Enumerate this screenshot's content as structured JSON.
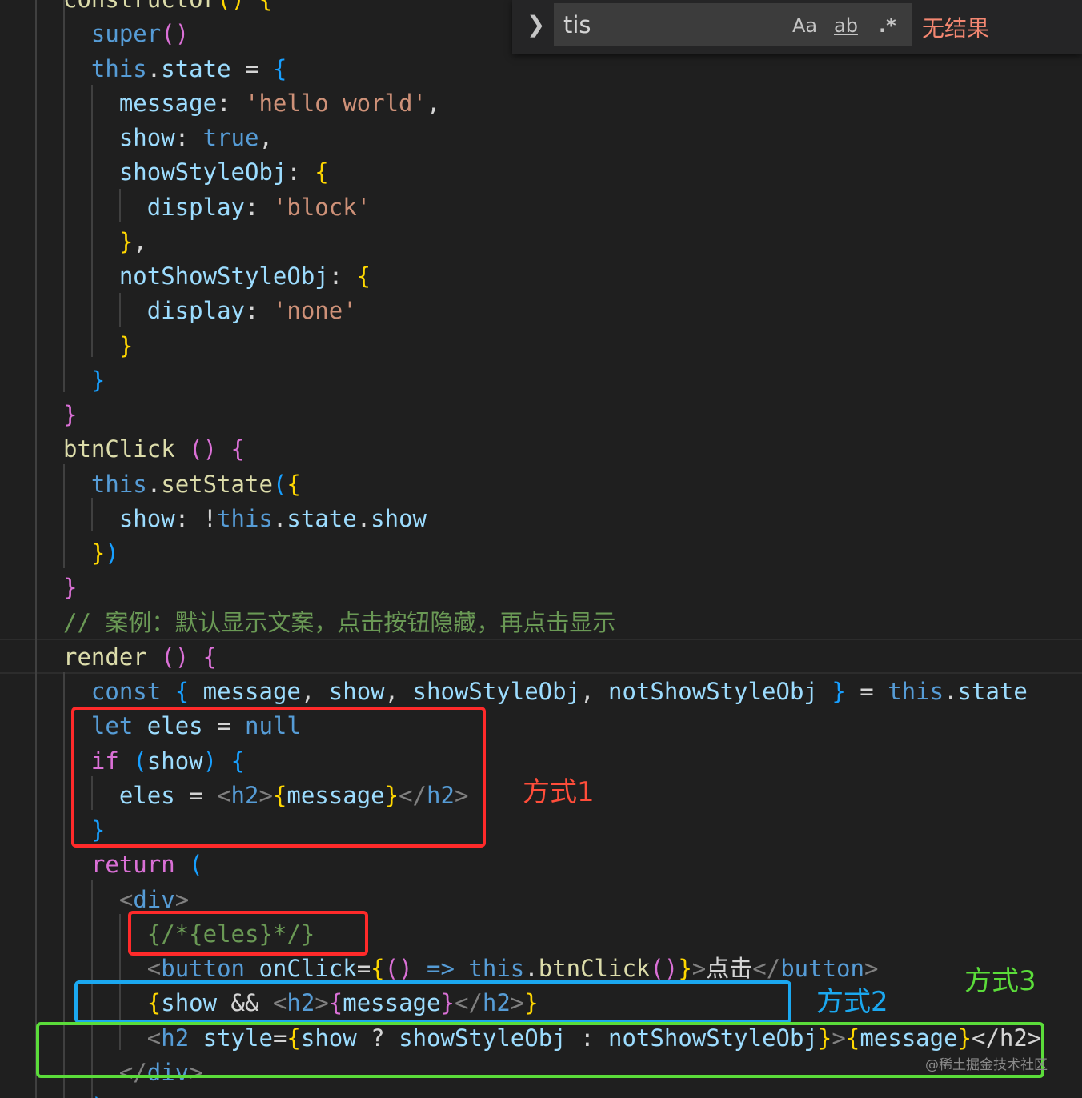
{
  "find_widget": {
    "query": "tis",
    "match_case": "Aa",
    "whole_word": "ab",
    "regex": ".*",
    "status": "无结果"
  },
  "code_lines": [
    [
      {
        "t": "constructor",
        "c": "t-func"
      },
      {
        "t": "() {",
        "c": "t-gold"
      }
    ],
    [
      {
        "t": "  "
      },
      {
        "t": "super",
        "c": "t-blue"
      },
      {
        "t": "()",
        "c": "t-pink"
      }
    ],
    [
      {
        "t": "  "
      },
      {
        "t": "this",
        "c": "t-blue"
      },
      {
        "t": "."
      },
      {
        "t": "state",
        "c": "t-var"
      },
      {
        "t": " = "
      },
      {
        "t": "{",
        "c": "t-bright"
      }
    ],
    [
      {
        "t": "    "
      },
      {
        "t": "message",
        "c": "t-var"
      },
      {
        "t": ": "
      },
      {
        "t": "'hello world'",
        "c": "t-str"
      },
      {
        "t": ","
      }
    ],
    [
      {
        "t": "    "
      },
      {
        "t": "show",
        "c": "t-var"
      },
      {
        "t": ": "
      },
      {
        "t": "true",
        "c": "t-blue"
      },
      {
        "t": ","
      }
    ],
    [
      {
        "t": "    "
      },
      {
        "t": "showStyleObj",
        "c": "t-var"
      },
      {
        "t": ": "
      },
      {
        "t": "{",
        "c": "t-gold"
      }
    ],
    [
      {
        "t": "      "
      },
      {
        "t": "display",
        "c": "t-var"
      },
      {
        "t": ": "
      },
      {
        "t": "'block'",
        "c": "t-str"
      }
    ],
    [
      {
        "t": "    "
      },
      {
        "t": "}",
        "c": "t-gold"
      },
      {
        "t": ","
      }
    ],
    [
      {
        "t": "    "
      },
      {
        "t": "notShowStyleObj",
        "c": "t-var"
      },
      {
        "t": ": "
      },
      {
        "t": "{",
        "c": "t-gold"
      }
    ],
    [
      {
        "t": "      "
      },
      {
        "t": "display",
        "c": "t-var"
      },
      {
        "t": ": "
      },
      {
        "t": "'none'",
        "c": "t-str"
      }
    ],
    [
      {
        "t": "    "
      },
      {
        "t": "}",
        "c": "t-gold"
      }
    ],
    [
      {
        "t": "  "
      },
      {
        "t": "}",
        "c": "t-bright"
      }
    ],
    [
      {
        "t": "}",
        "c": "t-pink"
      }
    ],
    [
      {
        "t": "btnClick",
        "c": "t-func"
      },
      {
        "t": " "
      },
      {
        "t": "()",
        "c": "t-pink"
      },
      {
        "t": " "
      },
      {
        "t": "{",
        "c": "t-pink"
      }
    ],
    [
      {
        "t": "  "
      },
      {
        "t": "this",
        "c": "t-blue"
      },
      {
        "t": "."
      },
      {
        "t": "setState",
        "c": "t-func"
      },
      {
        "t": "(",
        "c": "t-bright"
      },
      {
        "t": "{",
        "c": "t-gold"
      }
    ],
    [
      {
        "t": "    "
      },
      {
        "t": "show",
        "c": "t-var"
      },
      {
        "t": ": !"
      },
      {
        "t": "this",
        "c": "t-blue"
      },
      {
        "t": "."
      },
      {
        "t": "state",
        "c": "t-var"
      },
      {
        "t": "."
      },
      {
        "t": "show",
        "c": "t-var"
      }
    ],
    [
      {
        "t": "  "
      },
      {
        "t": "}",
        "c": "t-gold"
      },
      {
        "t": ")",
        "c": "t-bright"
      }
    ],
    [
      {
        "t": "}",
        "c": "t-pink"
      }
    ],
    [
      {
        "t": "// 案例：默认显示文案，点击按钮隐藏，再点击显示",
        "c": "t-com"
      }
    ],
    [
      {
        "t": "render",
        "c": "t-func"
      },
      {
        "t": " "
      },
      {
        "t": "()",
        "c": "t-pink"
      },
      {
        "t": " "
      },
      {
        "t": "{",
        "c": "t-pink"
      }
    ],
    [
      {
        "t": "  "
      },
      {
        "t": "const",
        "c": "t-blue"
      },
      {
        "t": " "
      },
      {
        "t": "{",
        "c": "t-bright"
      },
      {
        "t": " "
      },
      {
        "t": "message",
        "c": "t-var"
      },
      {
        "t": ", "
      },
      {
        "t": "show",
        "c": "t-var"
      },
      {
        "t": ", "
      },
      {
        "t": "showStyleObj",
        "c": "t-var"
      },
      {
        "t": ", "
      },
      {
        "t": "notShowStyleObj",
        "c": "t-var"
      },
      {
        "t": " "
      },
      {
        "t": "}",
        "c": "t-bright"
      },
      {
        "t": " = "
      },
      {
        "t": "this",
        "c": "t-blue"
      },
      {
        "t": "."
      },
      {
        "t": "state",
        "c": "t-var"
      }
    ],
    [
      {
        "t": "  "
      },
      {
        "t": "let",
        "c": "t-blue"
      },
      {
        "t": " "
      },
      {
        "t": "eles",
        "c": "t-var"
      },
      {
        "t": " = "
      },
      {
        "t": "null",
        "c": "t-blue"
      }
    ],
    [
      {
        "t": "  "
      },
      {
        "t": "if",
        "c": "t-pink"
      },
      {
        "t": " "
      },
      {
        "t": "(",
        "c": "t-bright"
      },
      {
        "t": "show",
        "c": "t-var"
      },
      {
        "t": ")",
        "c": "t-bright"
      },
      {
        "t": " "
      },
      {
        "t": "{",
        "c": "t-bright"
      }
    ],
    [
      {
        "t": "    "
      },
      {
        "t": "eles",
        "c": "t-var"
      },
      {
        "t": " = "
      },
      {
        "t": "<",
        "c": "t-tag"
      },
      {
        "t": "h2",
        "c": "t-blue"
      },
      {
        "t": ">",
        "c": "t-tag"
      },
      {
        "t": "{",
        "c": "t-gold"
      },
      {
        "t": "message",
        "c": "t-var"
      },
      {
        "t": "}",
        "c": "t-gold"
      },
      {
        "t": "</",
        "c": "t-tag"
      },
      {
        "t": "h2",
        "c": "t-blue"
      },
      {
        "t": ">",
        "c": "t-tag"
      }
    ],
    [
      {
        "t": "  "
      },
      {
        "t": "}",
        "c": "t-bright"
      }
    ],
    [
      {
        "t": "  "
      },
      {
        "t": "return",
        "c": "t-pink"
      },
      {
        "t": " "
      },
      {
        "t": "(",
        "c": "t-bright"
      }
    ],
    [
      {
        "t": "    "
      },
      {
        "t": "<",
        "c": "t-tag"
      },
      {
        "t": "div",
        "c": "t-blue"
      },
      {
        "t": ">",
        "c": "t-tag"
      }
    ],
    [
      {
        "t": "      "
      },
      {
        "t": "{/*{eles}*/}",
        "c": "t-com"
      }
    ],
    [
      {
        "t": "      "
      },
      {
        "t": "<",
        "c": "t-tag"
      },
      {
        "t": "button",
        "c": "t-blue"
      },
      {
        "t": " "
      },
      {
        "t": "onClick",
        "c": "t-var"
      },
      {
        "t": "="
      },
      {
        "t": "{",
        "c": "t-gold"
      },
      {
        "t": "()",
        "c": "t-pink"
      },
      {
        "t": " "
      },
      {
        "t": "=>",
        "c": "t-blue"
      },
      {
        "t": " "
      },
      {
        "t": "this",
        "c": "t-blue"
      },
      {
        "t": "."
      },
      {
        "t": "btnClick",
        "c": "t-func"
      },
      {
        "t": "()",
        "c": "t-pink"
      },
      {
        "t": "}",
        "c": "t-gold"
      },
      {
        "t": ">",
        "c": "t-tag"
      },
      {
        "t": "点击"
      },
      {
        "t": "</",
        "c": "t-tag"
      },
      {
        "t": "button",
        "c": "t-blue"
      },
      {
        "t": ">",
        "c": "t-tag"
      }
    ],
    [
      {
        "t": "      "
      },
      {
        "t": "{",
        "c": "t-gold"
      },
      {
        "t": "show",
        "c": "t-var"
      },
      {
        "t": " && "
      },
      {
        "t": "<",
        "c": "t-tag"
      },
      {
        "t": "h2",
        "c": "t-blue"
      },
      {
        "t": ">",
        "c": "t-tag"
      },
      {
        "t": "{",
        "c": "t-pink"
      },
      {
        "t": "message",
        "c": "t-var"
      },
      {
        "t": "}",
        "c": "t-pink"
      },
      {
        "t": "</",
        "c": "t-tag"
      },
      {
        "t": "h2",
        "c": "t-blue"
      },
      {
        "t": ">",
        "c": "t-tag"
      },
      {
        "t": "}",
        "c": "t-gold"
      }
    ],
    [
      {
        "t": "      "
      },
      {
        "t": "<",
        "c": "t-tag"
      },
      {
        "t": "h2",
        "c": "t-blue"
      },
      {
        "t": " "
      },
      {
        "t": "style",
        "c": "t-var"
      },
      {
        "t": "="
      },
      {
        "t": "{",
        "c": "t-gold"
      },
      {
        "t": "show",
        "c": "t-var"
      },
      {
        "t": " ? "
      },
      {
        "t": "showStyleObj",
        "c": "t-var"
      },
      {
        "t": " : "
      },
      {
        "t": "notShowStyleObj",
        "c": "t-var"
      },
      {
        "t": "}",
        "c": "t-gold"
      },
      {
        "t": ">",
        "c": "t-tag"
      },
      {
        "t": "{",
        "c": "t-gold"
      },
      {
        "t": "message",
        "c": "t-var"
      },
      {
        "t": "}",
        "c": "t-gold"
      },
      {
        "t": "</h2>",
        "c": "t-white"
      }
    ],
    [
      {
        "t": "    "
      },
      {
        "t": "</",
        "c": "t-tag"
      },
      {
        "t": "div",
        "c": "t-blue"
      },
      {
        "t": ">",
        "c": "t-tag"
      }
    ],
    [
      {
        "t": "  "
      },
      {
        "t": ")",
        "c": "t-bright"
      }
    ]
  ],
  "annotations": {
    "method1": "方式1",
    "method2": "方式2",
    "method3": "方式3"
  },
  "colors": {
    "red": "#ff2a2a",
    "blue": "#1ba8f0",
    "green": "#5bdc3a"
  },
  "watermark": "@稀土掘金技术社区"
}
